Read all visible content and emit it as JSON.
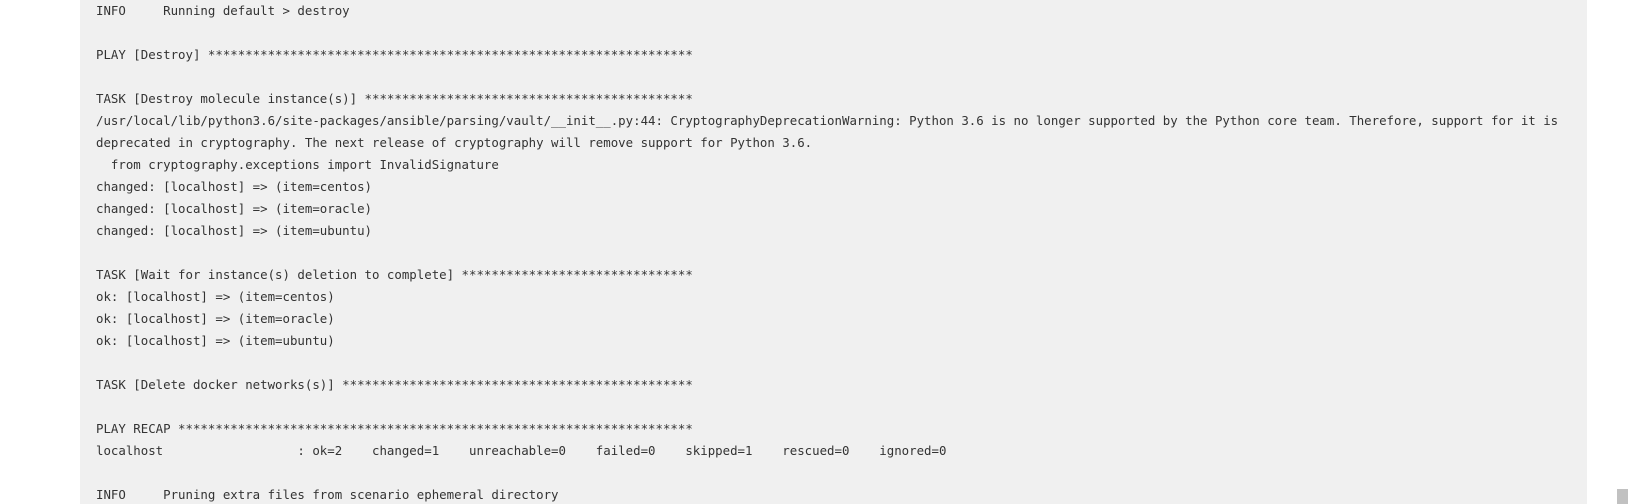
{
  "console": {
    "lines": [
      "INFO     Running default > destroy",
      "",
      "PLAY [Destroy] *****************************************************************",
      "",
      "TASK [Destroy molecule instance(s)] ********************************************",
      "/usr/local/lib/python3.6/site-packages/ansible/parsing/vault/__init__.py:44: CryptographyDeprecationWarning: Python 3.6 is no longer supported by the Python core team. Therefore, support for it is",
      "deprecated in cryptography. The next release of cryptography will remove support for Python 3.6.",
      "  from cryptography.exceptions import InvalidSignature",
      "changed: [localhost] => (item=centos)",
      "changed: [localhost] => (item=oracle)",
      "changed: [localhost] => (item=ubuntu)",
      "",
      "TASK [Wait for instance(s) deletion to complete] *******************************",
      "ok: [localhost] => (item=centos)",
      "ok: [localhost] => (item=oracle)",
      "ok: [localhost] => (item=ubuntu)",
      "",
      "TASK [Delete docker networks(s)] ***********************************************",
      "",
      "PLAY RECAP *********************************************************************",
      "localhost                  : ok=2    changed=1    unreachable=0    failed=0    skipped=1    rescued=0    ignored=0",
      "",
      "INFO     Pruning extra files from scenario ephemeral directory"
    ]
  }
}
